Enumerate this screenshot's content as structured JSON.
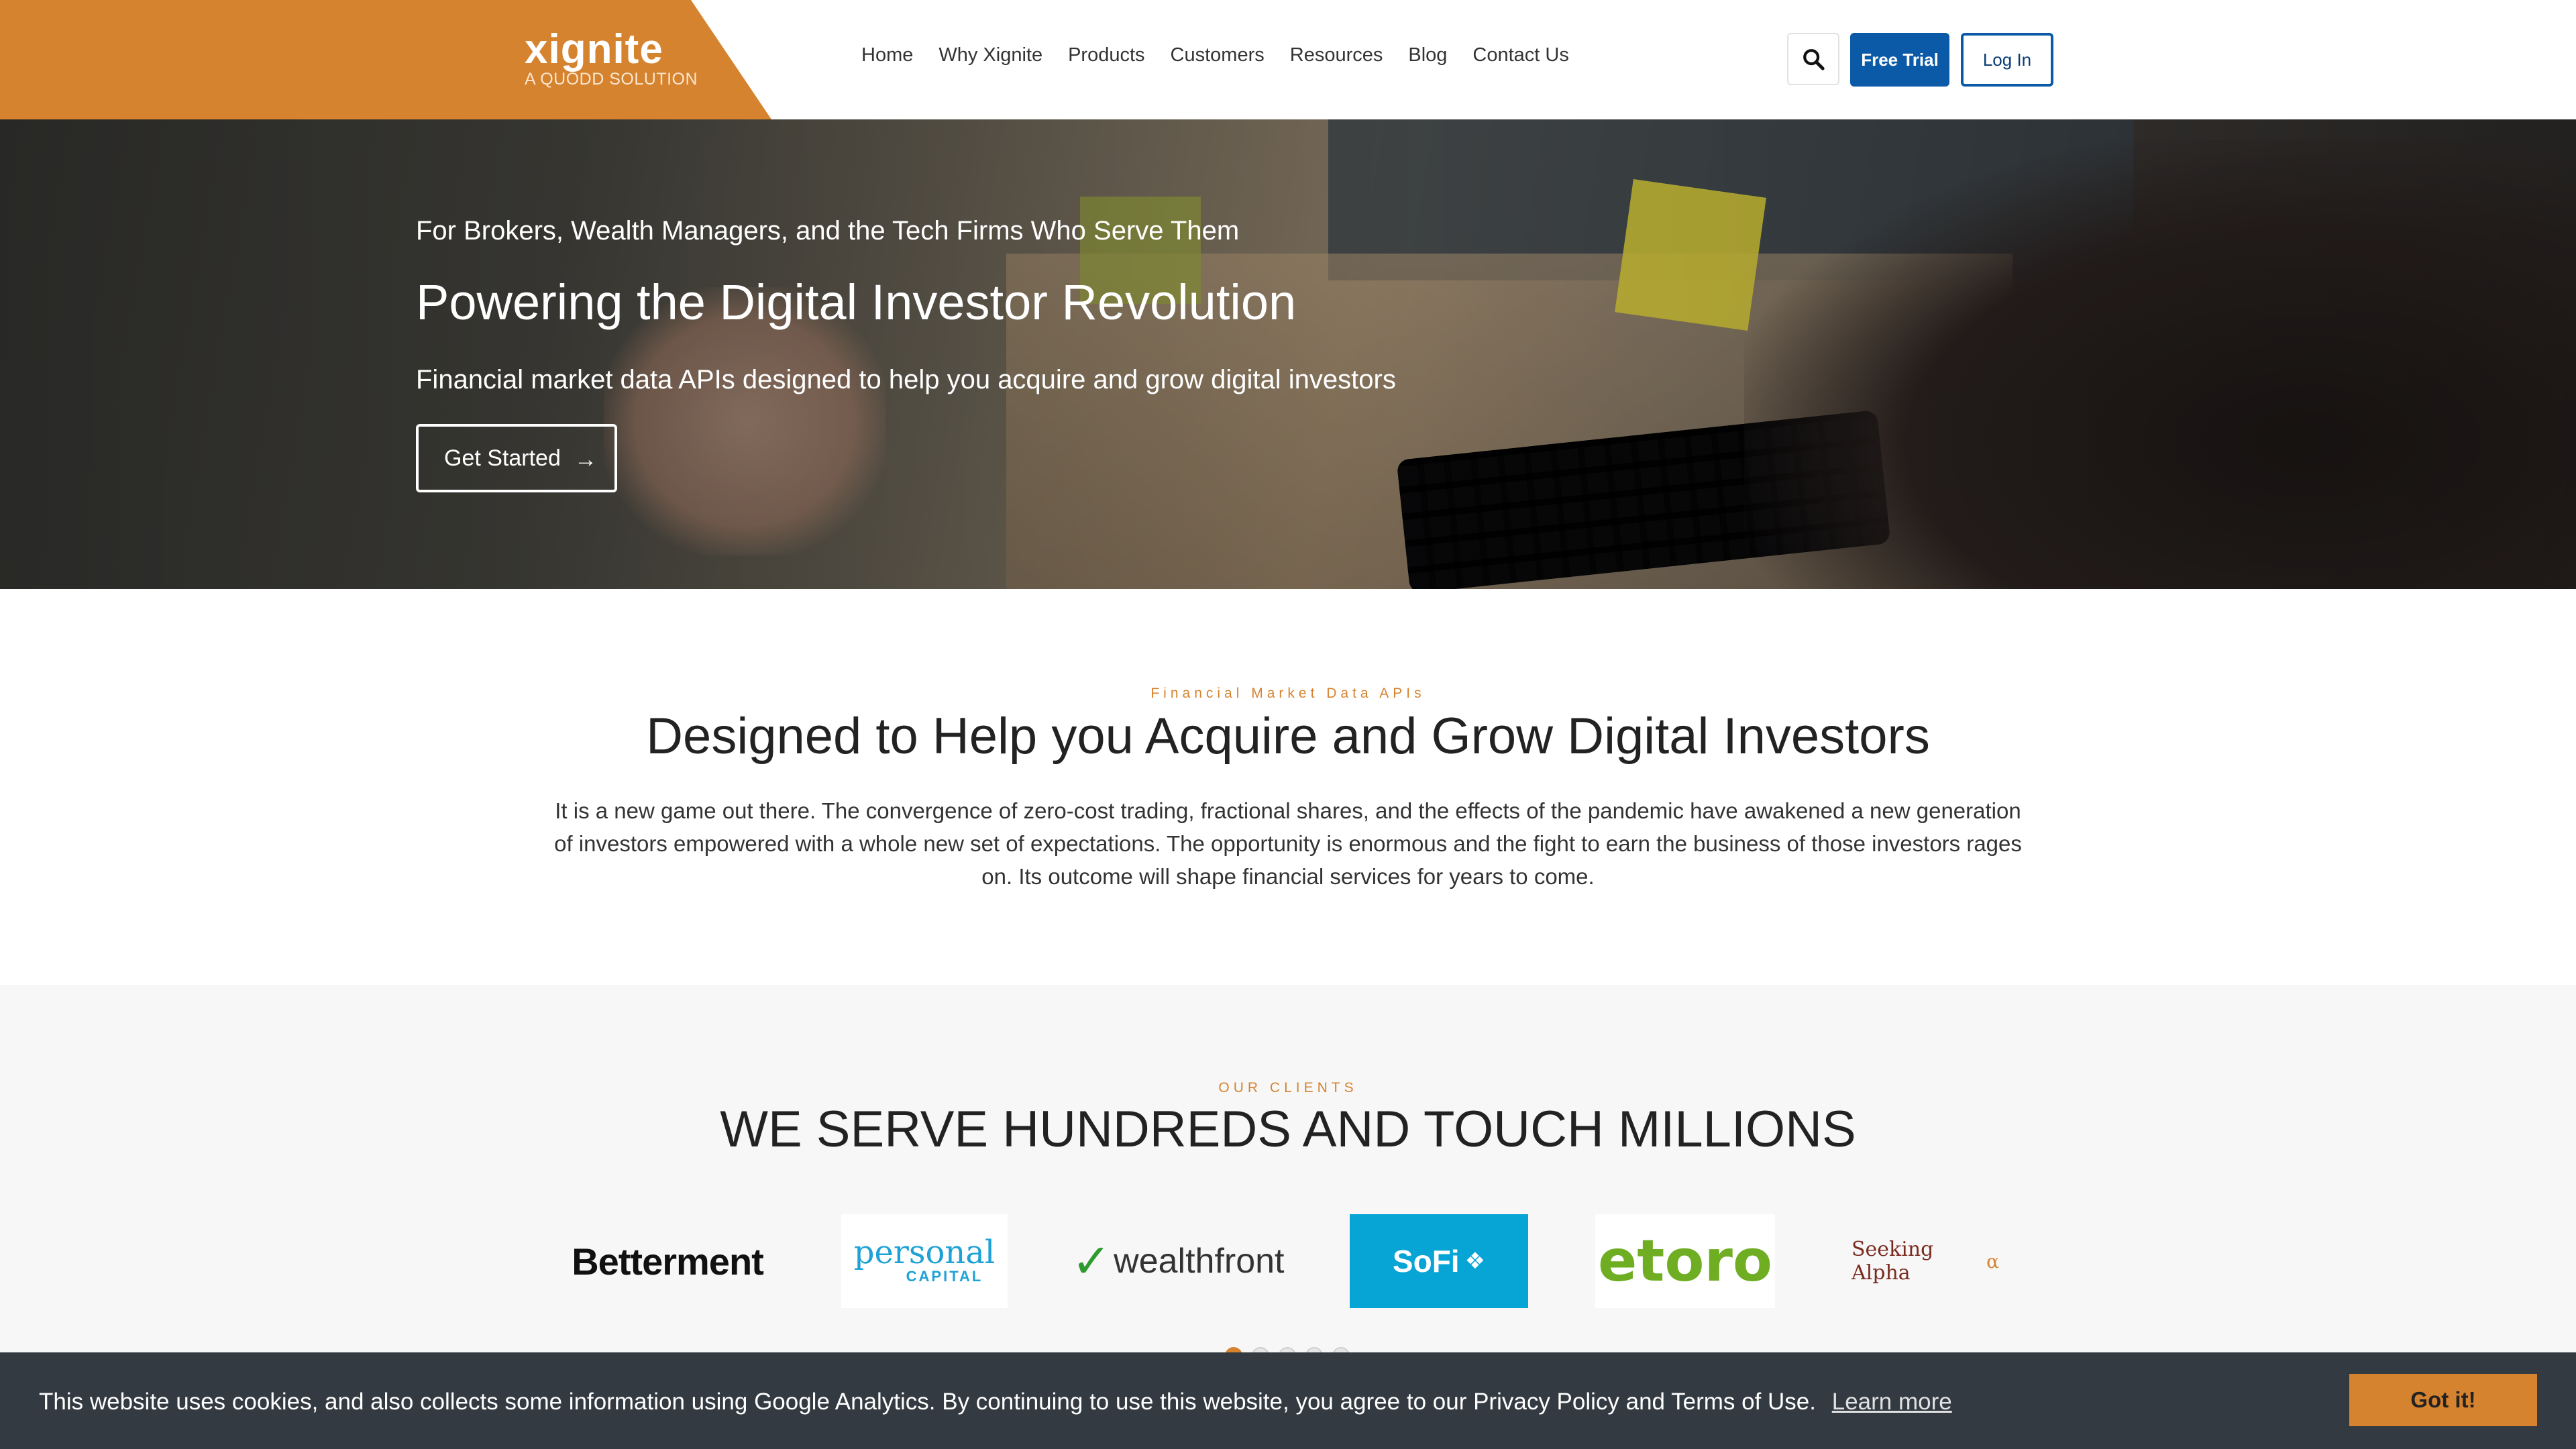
{
  "brand": {
    "name": "xignite",
    "tagline": "A QUODD SOLUTION",
    "accent_color": "#d6832f",
    "primary_color": "#0a5aa8"
  },
  "nav": {
    "items": [
      "Home",
      "Why Xignite",
      "Products",
      "Customers",
      "Resources",
      "Blog",
      "Contact Us"
    ],
    "search_icon": "search-icon",
    "free_trial_label": "Free Trial",
    "login_label": "Log In"
  },
  "hero": {
    "eyebrow": "For Brokers, Wealth Managers, and the Tech Firms Who Serve Them",
    "title": "Powering the Digital Investor Revolution",
    "subtitle": "Financial market data APIs designed to help you acquire and grow digital investors",
    "cta_label": "Get Started",
    "cta_icon": "arrow-right-icon"
  },
  "intro": {
    "eyebrow": "Financial Market Data APIs",
    "title": "Designed to Help you Acquire and Grow Digital Investors",
    "body": "It is a new game out there. The convergence of zero-cost trading, fractional shares, and the effects of the pandemic have awakened a new generation of investors empowered with a whole new set of expectations. The opportunity is enormous and the fight to earn the business of those investors rages on. Its outcome will shape financial services for years to come."
  },
  "clients": {
    "eyebrow": "OUR CLIENTS",
    "title": "WE SERVE HUNDREDS AND TOUCH MILLIONS",
    "logos": {
      "betterment": "Betterment",
      "personal_capital_top": "personal",
      "personal_capital_bottom": "CAPITAL",
      "wealthfront": "wealthfront",
      "sofi": "SoFi",
      "etoro": "etoro",
      "seeking_alpha": "Seeking Alpha",
      "seeking_alpha_mark": "α"
    },
    "carousel_active_index": 0
  },
  "cookie": {
    "message": "This website uses cookies, and also collects some information using Google Analytics. By continuing to use this website, you agree to our Privacy Policy and Terms of Use.",
    "link_label": "Learn more",
    "button_label": "Got it!"
  }
}
